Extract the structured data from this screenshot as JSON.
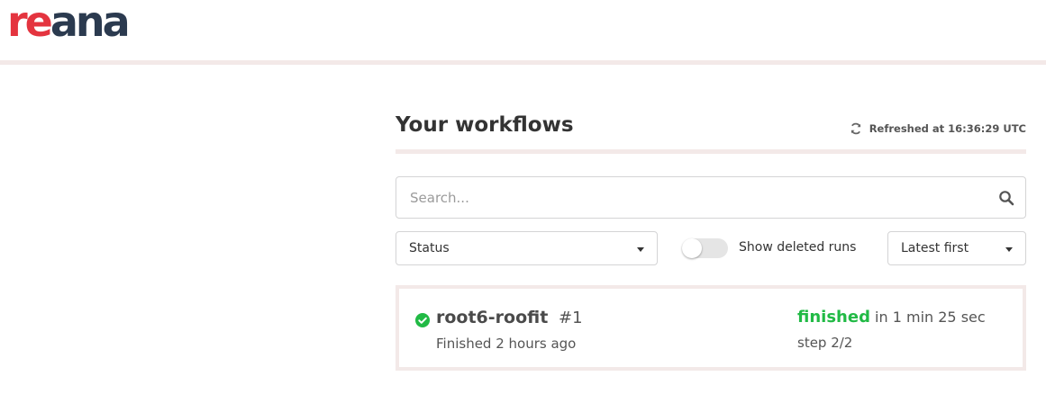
{
  "header": {
    "logo_part1": "re",
    "logo_part2": "ana"
  },
  "main": {
    "title": "Your workflows",
    "refreshed": "Refreshed at 16:36:29 UTC"
  },
  "search": {
    "placeholder": "Search..."
  },
  "filters": {
    "status_label": "Status",
    "show_deleted_label": "Show deleted runs",
    "show_deleted_on": false,
    "sort_label": "Latest first"
  },
  "workflows": [
    {
      "name": "root6-roofit",
      "run": "#1",
      "time": "Finished 2 hours ago",
      "status": "finished",
      "duration": "in 1 min 25 sec",
      "step": "step 2/2",
      "status_color": "#21ba45"
    }
  ],
  "colors": {
    "brand_red": "#e4343f",
    "brand_navy": "#2b3a4f",
    "success": "#21ba45",
    "divider": "#f3e9e8"
  },
  "icons": {
    "refresh": "refresh-icon",
    "search": "search-icon",
    "status": "check-circle-icon",
    "dropdown": "caret-down-icon"
  }
}
